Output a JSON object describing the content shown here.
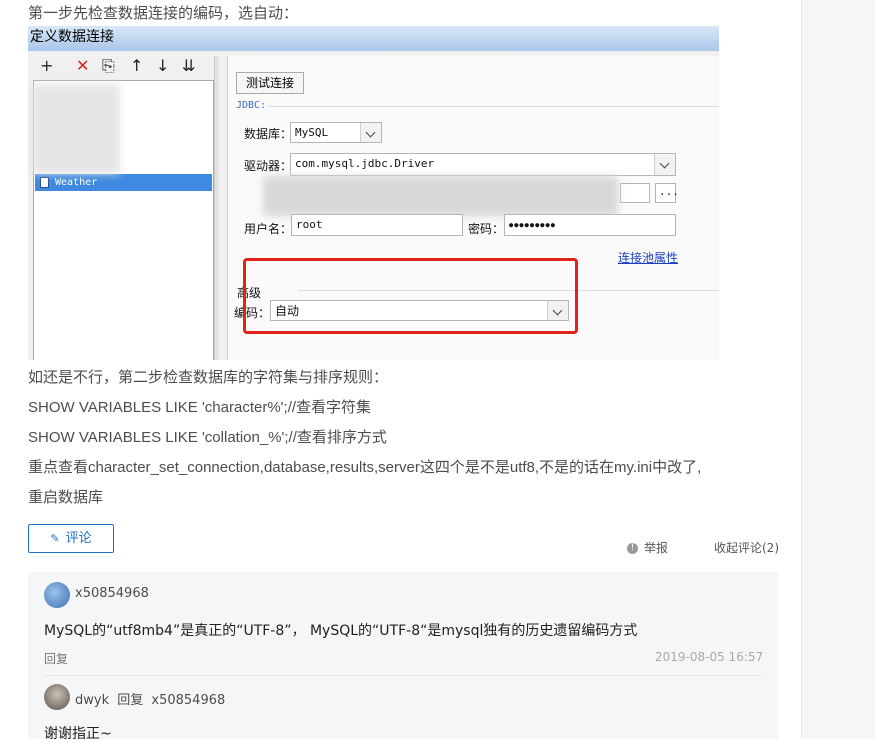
{
  "intro": "第一步先检查数据连接的编码，选自动：",
  "dialog": {
    "title": "定义数据连接",
    "toolbar": [
      "+",
      "✕",
      "⎘",
      "↑",
      "↓",
      "⇊"
    ],
    "tree_selected": "Weather",
    "test_button": "测试连接",
    "jdbc_label": "JDBC:",
    "db_label": "数据库：",
    "db_value": "MySQL",
    "driver_label": "驱动器：",
    "driver_value": "com.mysql.jdbc.Driver",
    "user_label": "用户名：",
    "user_value": "root",
    "password_label": "密码：",
    "password_value": "●●●●●●●●●",
    "pool_link": "连接池属性",
    "advanced_label": "高级",
    "encoding_label": "编码：",
    "encoding_value": "自动",
    "url_btn": "..."
  },
  "article": {
    "p1": "如还是不行，第二步检查数据库的字符集与排序规则：",
    "p2": "SHOW VARIABLES LIKE 'character%';//查看字符集",
    "p3": "SHOW VARIABLES LIKE 'collation_%';//查看排序方式",
    "p4": "重点查看character_set_connection,database,results,server这四个是不是utf8,不是的话在my.ini中改了,",
    "p5": "重启数据库"
  },
  "actions": {
    "comment": "评论",
    "report": "举报",
    "collapse": "收起评论(2)"
  },
  "comments": [
    {
      "user": "x50854968",
      "text": "MySQL的“utf8mb4”是真正的“UTF-8”， MySQL的“UTF-8“是mysql独有的历史遗留编码方式",
      "reply": "回复",
      "time": "2019-08-05 16:57"
    },
    {
      "user": "dwyk",
      "reply_word": "回复",
      "reply_to": "x50854968",
      "text": "谢谢指正~"
    }
  ],
  "colors": {
    "accent": "#1a73c9",
    "highlight": "#e2231a",
    "selection": "#3f8ae0"
  }
}
